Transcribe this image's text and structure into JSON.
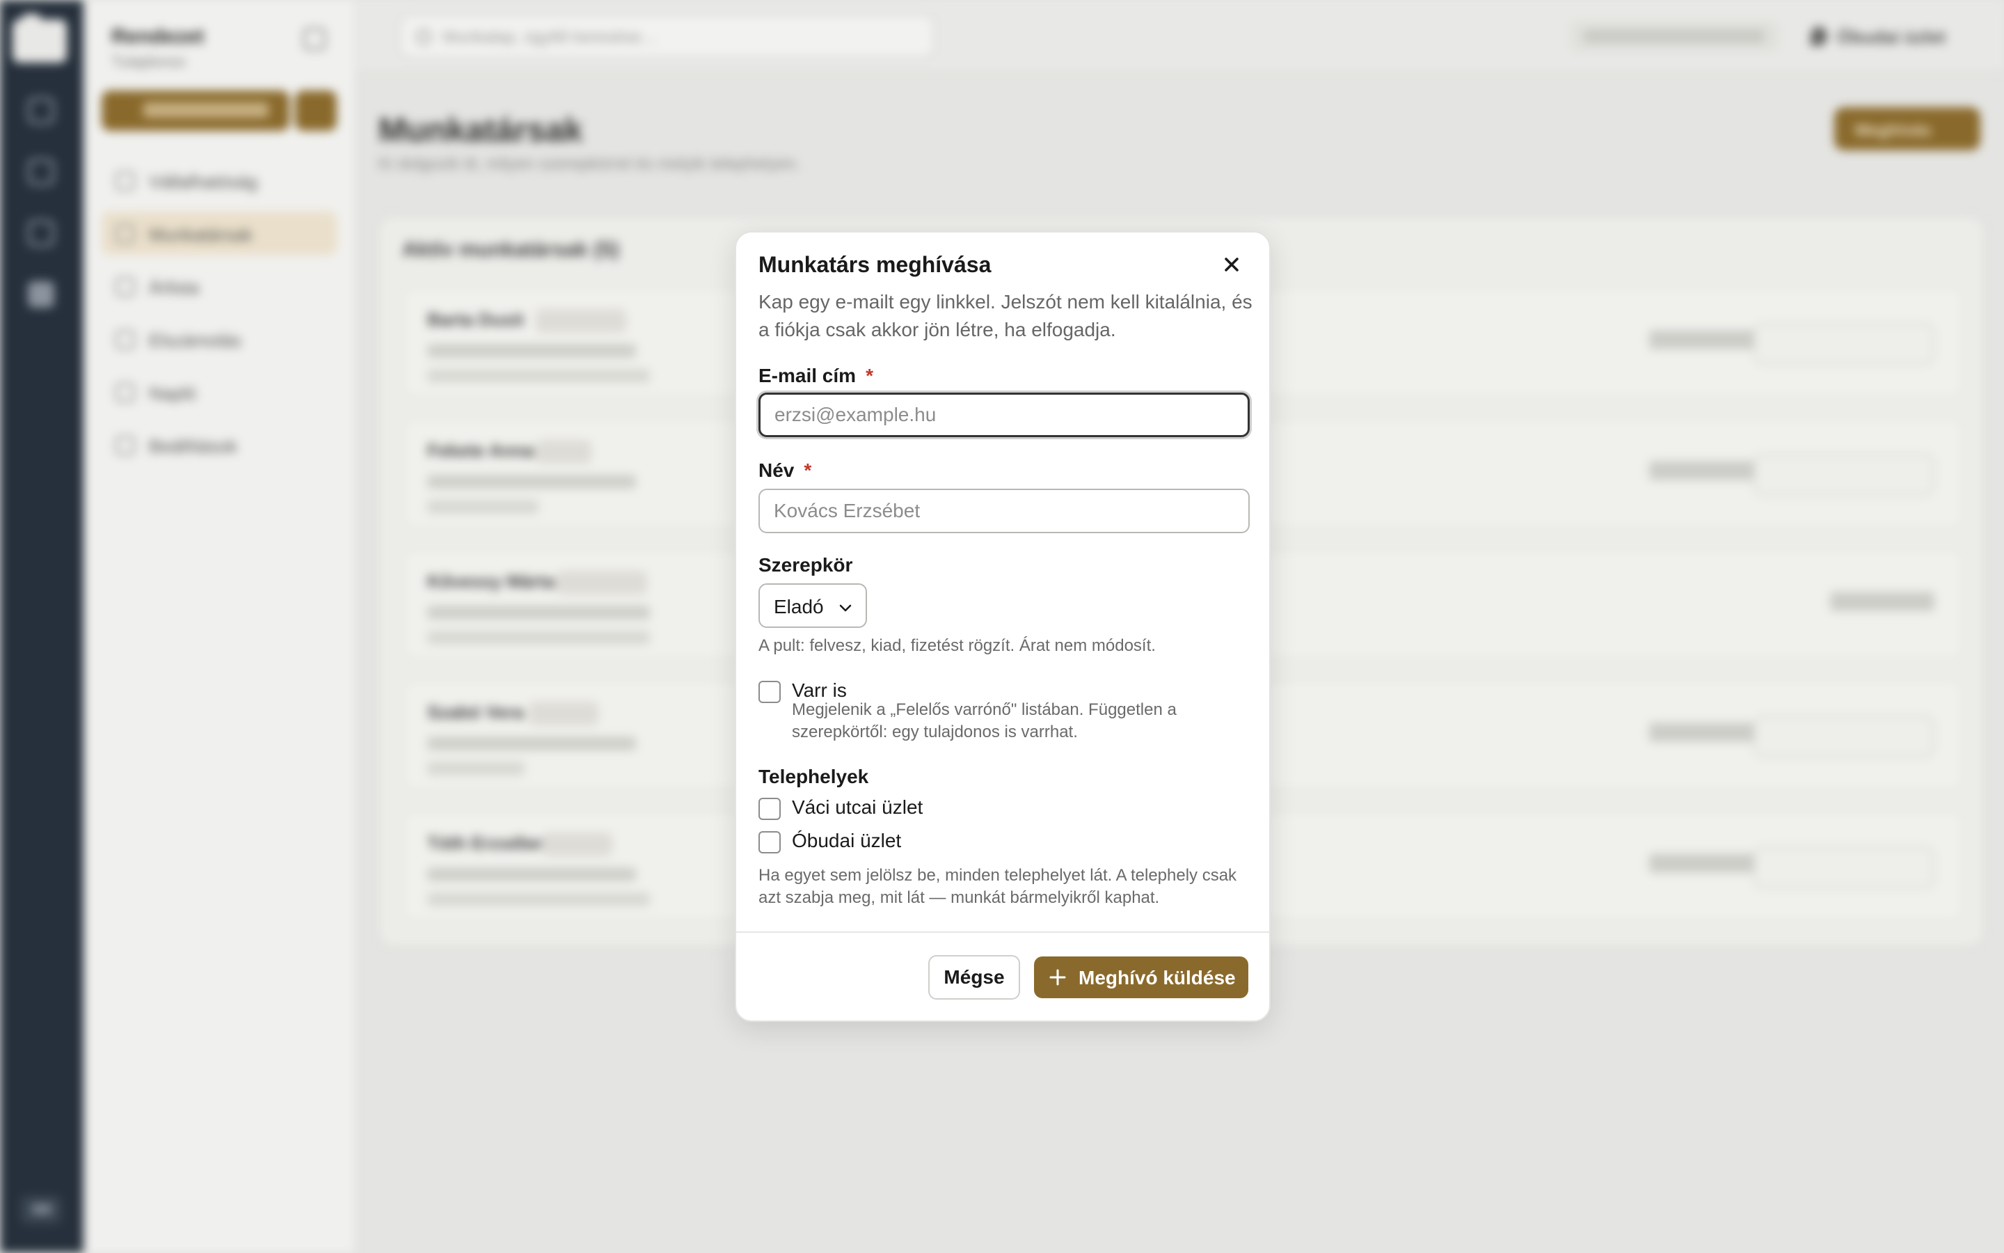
{
  "background": {
    "sidebar": {
      "title": "Rendezet",
      "subtitle": "Tulajdonos",
      "items": [
        {
          "label": "Vállalhatóság"
        },
        {
          "label": "Munkatársak"
        },
        {
          "label": "Árlista"
        },
        {
          "label": "Elszámolás"
        },
        {
          "label": "Napló"
        },
        {
          "label": "Beállítások"
        }
      ]
    },
    "topbar": {
      "search_placeholder": "Munkalap, ügyfél keresése…",
      "location": "Óbudai üzlet"
    },
    "page": {
      "title": "Munkatársak",
      "description": "Ki dolgozik itt, milyen szerepkörrel és melyik telephelyen.",
      "invite_label": "Meghívás",
      "list_title": "Aktív munkatársak (5)",
      "rows": [
        {
          "name": "Barta Dusit"
        },
        {
          "name": "Fekete Anna"
        },
        {
          "name": "Kővessy Márta"
        },
        {
          "name": "Szabó Vera"
        },
        {
          "name": "Tóth Erzsébet"
        }
      ]
    }
  },
  "modal": {
    "title": "Munkatárs meghívása",
    "description": "Kap egy e-mailt egy linkkel. Jelszót nem kell kitalálnia, és a fiókja csak akkor jön létre, ha elfogadja.",
    "email": {
      "label": "E-mail cím",
      "required_mark": "*",
      "placeholder": "erzsi@example.hu",
      "value": ""
    },
    "name": {
      "label": "Név",
      "required_mark": "*",
      "placeholder": "Kovács Erzsébet",
      "value": ""
    },
    "role": {
      "label": "Szerepkör",
      "selected": "Eladó",
      "hint": "A pult: felvesz, kiad, fizetést rögzít. Árat nem módosít."
    },
    "sews": {
      "label": "Varr is",
      "checked": false,
      "hint": "Megjelenik a „Felelős varrónő\" listában. Független a szerepkörtől: egy tulajdonos is varrhat."
    },
    "locations": {
      "label": "Telephelyek",
      "options": [
        {
          "label": "Váci utcai üzlet",
          "checked": false
        },
        {
          "label": "Óbudai üzlet",
          "checked": false
        }
      ],
      "hint": "Ha egyet sem jelölsz be, minden telephelyet lát. A telephely csak azt szabja meg, mit lát — munkát bármelyikről kaphat."
    },
    "buttons": {
      "cancel": "Mégse",
      "submit": "Meghívó küldése"
    }
  },
  "colors": {
    "accent": "#8a6a2c",
    "required": "#c0392b",
    "rail": "#26303c"
  },
  "icons": {
    "close": "close-icon",
    "chevron": "chevron-down-icon",
    "plus": "plus-icon"
  }
}
